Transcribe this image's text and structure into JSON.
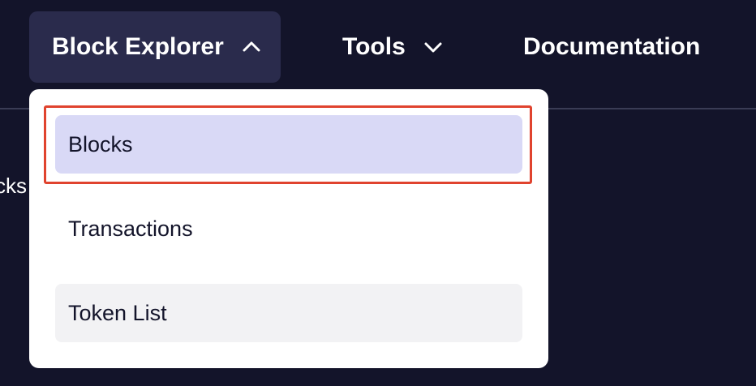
{
  "nav": {
    "block_explorer": "Block Explorer",
    "tools": "Tools",
    "documentation": "Documentation"
  },
  "partial_text": "cks",
  "dropdown": {
    "items": [
      {
        "label": "Blocks",
        "state": "selected"
      },
      {
        "label": "Transactions",
        "state": "default"
      },
      {
        "label": "Token List",
        "state": "hover"
      }
    ]
  },
  "colors": {
    "background": "#13142a",
    "active_nav_bg": "#2a2b4c",
    "selected_item_bg": "#d9d9f6",
    "hover_item_bg": "#f2f2f4",
    "highlight_border": "#e0432e"
  },
  "icons": {
    "block_explorer_chevron": "chevron-up-icon",
    "tools_chevron": "chevron-down-icon"
  }
}
